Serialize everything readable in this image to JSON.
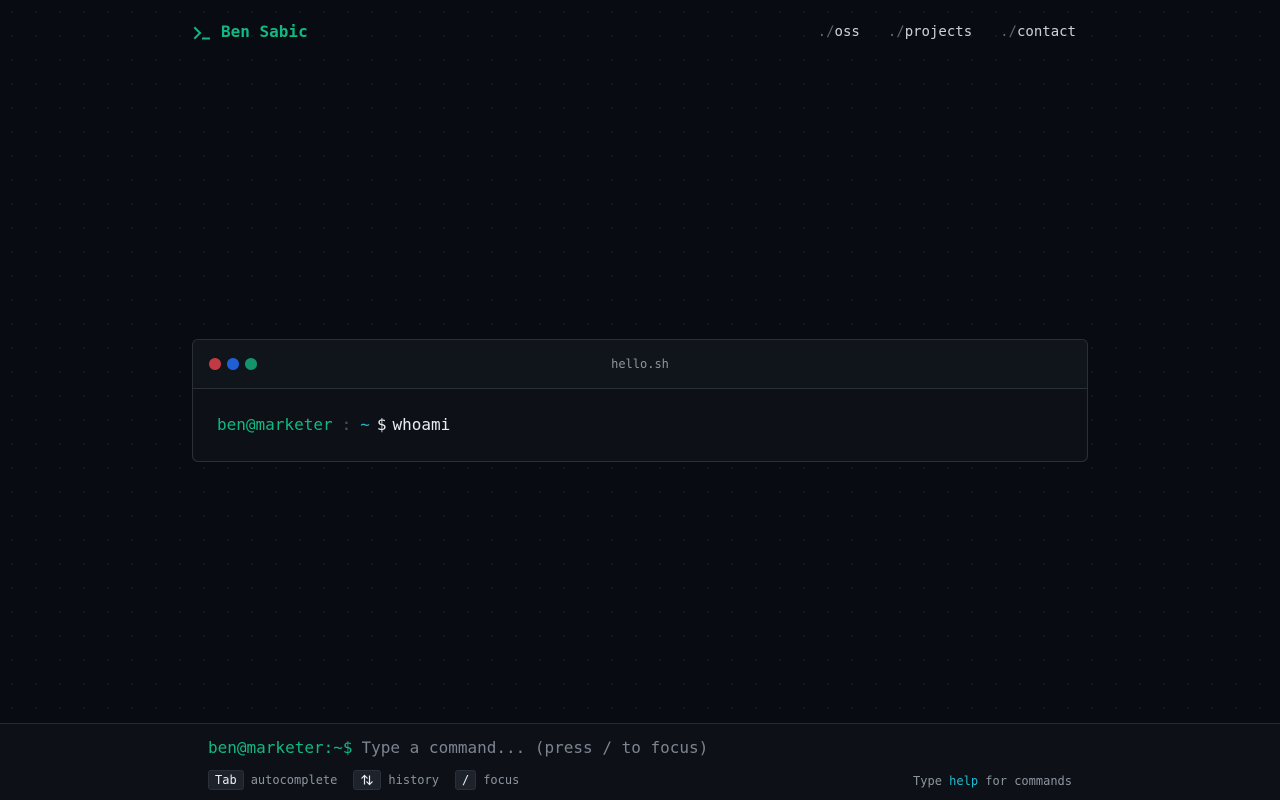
{
  "header": {
    "brand_icon": "terminal-prompt-icon",
    "brand_name": "Ben Sabic",
    "nav": [
      {
        "prefix": "./",
        "label": "oss"
      },
      {
        "prefix": "./",
        "label": "projects"
      },
      {
        "prefix": "./",
        "label": "contact"
      }
    ]
  },
  "terminal": {
    "title": "hello.sh",
    "window_controls": [
      "close-dot",
      "minimize-dot",
      "maximize-dot"
    ],
    "prompt": {
      "user_host": "ben@marketer",
      "separator": ":",
      "path": "~",
      "symbol": "$",
      "command": "whoami"
    }
  },
  "command_bar": {
    "prompt": "ben@marketer:~$",
    "placeholder": "Type a command... (press / to focus)",
    "value": "",
    "hints": [
      {
        "key": "Tab",
        "label": "autocomplete"
      },
      {
        "key_icon": "up-down-arrows-icon",
        "label": "history"
      },
      {
        "key": "/",
        "label": "focus"
      }
    ],
    "help": {
      "prefix": "Type",
      "keyword": "help",
      "suffix": "for commands"
    }
  },
  "colors": {
    "accent_green": "#10b981",
    "accent_cyan": "#22b8cf",
    "background": "#080b12",
    "dot_red": "#c23a44",
    "dot_blue": "#1f5fd6",
    "dot_green": "#13946a"
  }
}
